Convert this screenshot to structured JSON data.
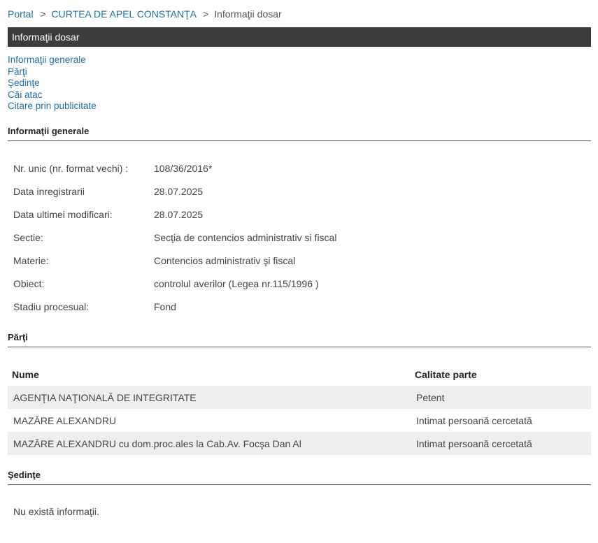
{
  "breadcrumb": {
    "items": [
      "Portal",
      "CURTEA DE APEL CONSTANŢA"
    ],
    "current": "Informaţii dosar",
    "separator": ">"
  },
  "title": "Informaţii dosar",
  "nav": {
    "items": [
      "Informaţii generale",
      "Părţi",
      "Şedinţe",
      "Căi atac",
      "Citare prin publicitate"
    ]
  },
  "sections": {
    "general": "Informaţii generale",
    "parti": "Părţi",
    "sedinte": "Şedinţe"
  },
  "general_info": [
    {
      "label": "Nr. unic (nr. format vechi) :",
      "value": "108/36/2016*"
    },
    {
      "label": "Data inregistrarii",
      "value": "28.07.2025"
    },
    {
      "label": "Data ultimei modificari:",
      "value": "28.07.2025"
    },
    {
      "label": "Sectie:",
      "value": "Secţia de contencios administrativ si fiscal"
    },
    {
      "label": "Materie:",
      "value": "Contencios administrativ şi fiscal"
    },
    {
      "label": "Obiect:",
      "value": "controlul averilor (Legea nr.115/1996 )"
    },
    {
      "label": "Stadiu procesual:",
      "value": "Fond"
    }
  ],
  "parti_table": {
    "headers": [
      "Nume",
      "Calitate parte"
    ],
    "rows": [
      [
        "AGENŢIA NAŢIONALĂ DE INTEGRITATE",
        "Petent"
      ],
      [
        "MAZĂRE ALEXANDRU",
        "Intimat persoană cercetată"
      ],
      [
        "MAZĂRE ALEXANDRU cu dom.proc.ales la Cab.Av. Focşa Dan Al",
        "Intimat persoană cercetată"
      ]
    ]
  },
  "sedinte_message": "Nu există informaţii.",
  "colors": {
    "link": "#1f6fa8",
    "titlebar_bg": "#3c3c3c",
    "row_alt": "#eeeeee"
  }
}
